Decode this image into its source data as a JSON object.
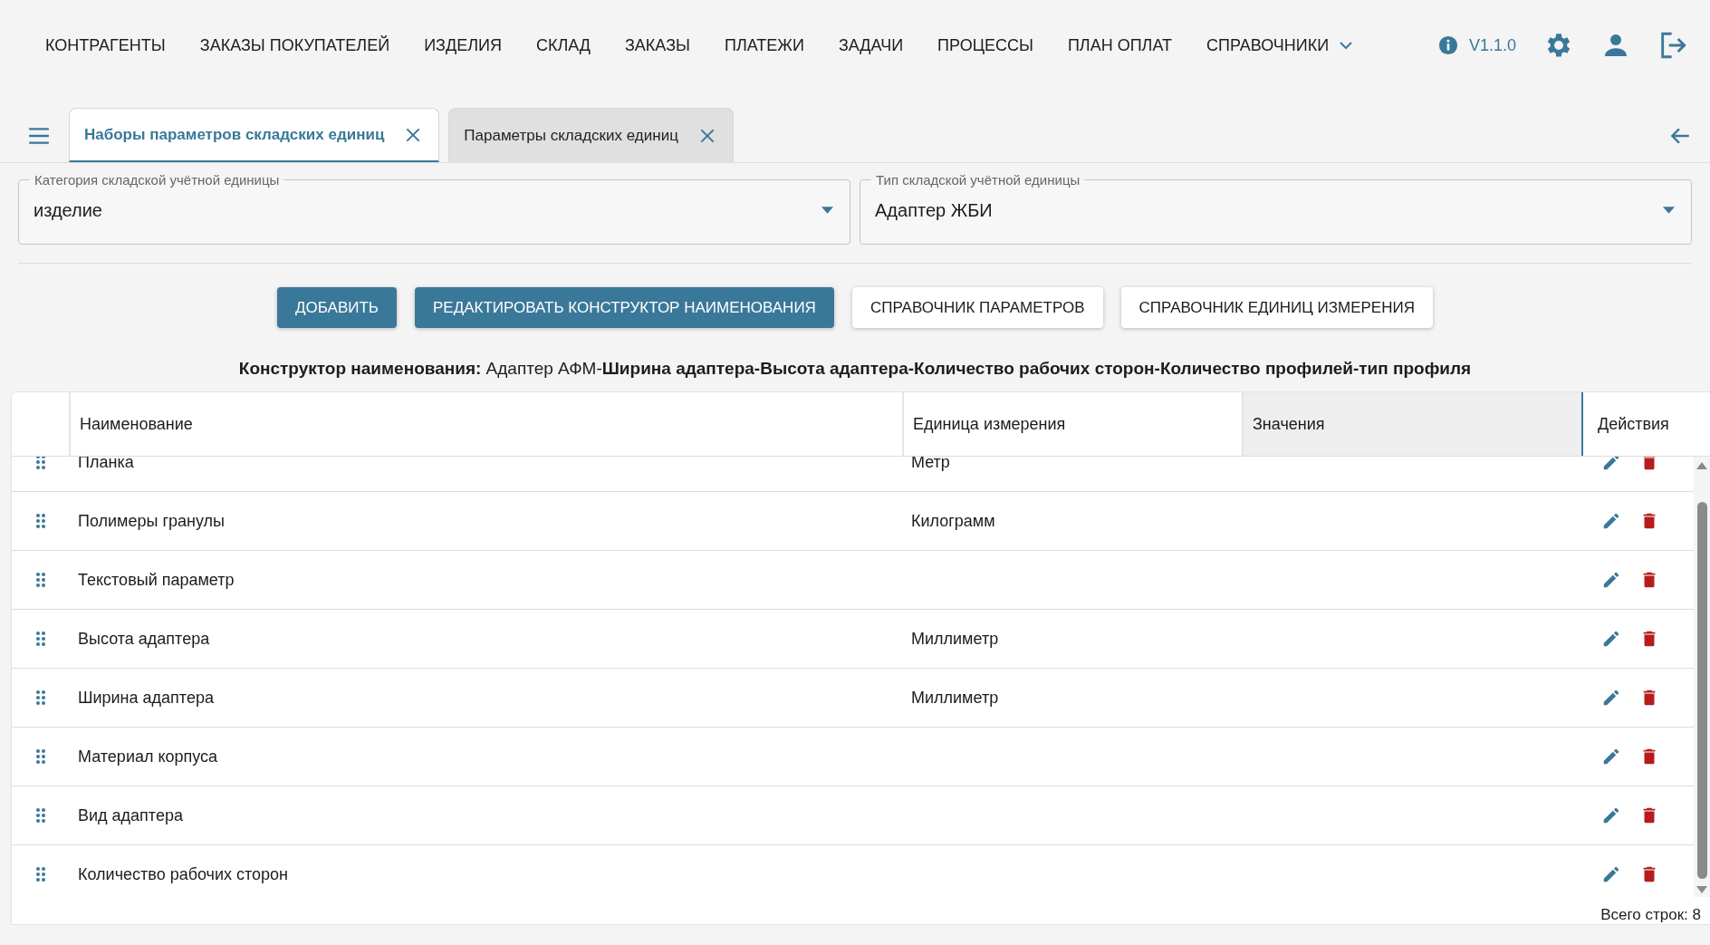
{
  "nav": {
    "items": [
      {
        "label": "КОНТРАГЕНТЫ",
        "dropdown": false
      },
      {
        "label": "ЗАКАЗЫ ПОКУПАТЕЛЕЙ",
        "dropdown": false
      },
      {
        "label": "ИЗДЕЛИЯ",
        "dropdown": false
      },
      {
        "label": "СКЛАД",
        "dropdown": false
      },
      {
        "label": "ЗАКАЗЫ",
        "dropdown": false
      },
      {
        "label": "ПЛАТЕЖИ",
        "dropdown": false
      },
      {
        "label": "ЗАДАЧИ",
        "dropdown": false
      },
      {
        "label": "ПРОЦЕССЫ",
        "dropdown": false
      },
      {
        "label": "ПЛАН ОПЛАТ",
        "dropdown": false
      },
      {
        "label": "СПРАВОЧНИКИ",
        "dropdown": true
      }
    ],
    "version": "V1.1.0"
  },
  "tabs": [
    {
      "label": "Наборы параметров складских единиц",
      "selected": true
    },
    {
      "label": "Параметры складских единиц",
      "selected": false
    }
  ],
  "filters": [
    {
      "label": "Категория складской учётной единицы",
      "value": "изделие"
    },
    {
      "label": "Тип складской учётной единицы",
      "value": "Адаптер ЖБИ"
    }
  ],
  "buttons": [
    {
      "label": "ДОБАВИТЬ",
      "kind": "primary"
    },
    {
      "label": "РЕДАКТИРОВАТЬ КОНСТРУКТОР НАИМЕНОВАНИЯ",
      "kind": "primary"
    },
    {
      "label": "СПРАВОЧНИК ПАРАМЕТРОВ",
      "kind": "secondary"
    },
    {
      "label": "СПРАВОЧНИК ЕДИНИЦ ИЗМЕРЕНИЯ",
      "kind": "secondary"
    }
  ],
  "name_constructor": "**Конструктор наименования:** Адаптер АФМ-**Ширина адаптера-Высота адаптера-Количество рабочих сторон-Количество профилей-тип профиля**",
  "table": {
    "columns": [
      {
        "label": "Наименование",
        "highlighted": false
      },
      {
        "label": "Единица измерения",
        "highlighted": false
      },
      {
        "label": "Значения",
        "highlighted": true
      },
      {
        "label": "Действия",
        "highlighted": false
      }
    ],
    "rows": [
      {
        "name": "Планка",
        "unit": "Метр"
      },
      {
        "name": "Полимеры гранулы",
        "unit": "Килограмм"
      },
      {
        "name": "Текстовый параметр",
        "unit": ""
      },
      {
        "name": "Высота адаптера",
        "unit": "Миллиметр"
      },
      {
        "name": "Ширина адаптера",
        "unit": "Миллиметр"
      },
      {
        "name": "Материал корпуса",
        "unit": ""
      },
      {
        "name": "Вид адаптера",
        "unit": ""
      },
      {
        "name": "Количество рабочих сторон",
        "unit": ""
      }
    ],
    "footer": "Всего строк: 8"
  }
}
